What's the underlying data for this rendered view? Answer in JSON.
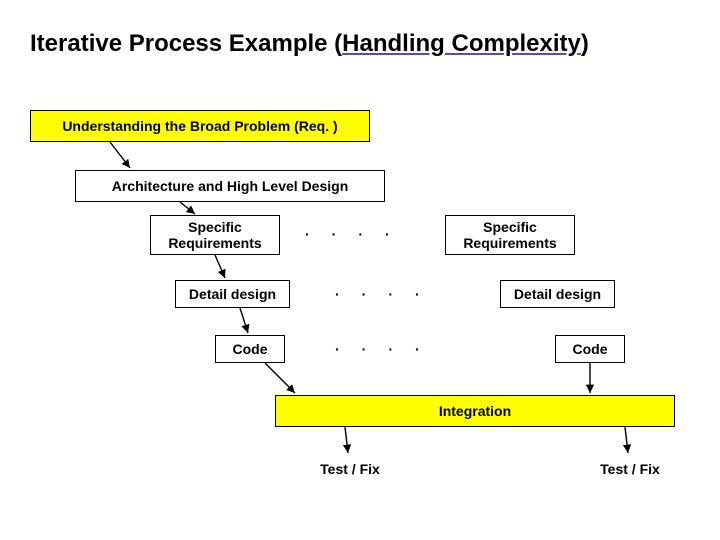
{
  "title": {
    "prefix": "Iterative Process Example (",
    "underlined": "Handling Complexity",
    "suffix": ")"
  },
  "boxes": {
    "understanding": "Understanding the Broad Problem (Req. )",
    "architecture": "Architecture and High Level Design",
    "specreq_left": "Specific\nRequirements",
    "specreq_right": "Specific\nRequirements",
    "detail_left": "Detail design",
    "detail_right": "Detail design",
    "code_left": "Code",
    "code_right": "Code",
    "integration": "Integration",
    "testfix_left": "Test / Fix",
    "testfix_right": "Test / Fix"
  },
  "dots": {
    "row1": [
      "·",
      "·",
      "·",
      "·"
    ],
    "row2": [
      "·",
      "·",
      "·",
      "·"
    ],
    "row3": [
      "·",
      "·",
      "·",
      "·"
    ]
  }
}
